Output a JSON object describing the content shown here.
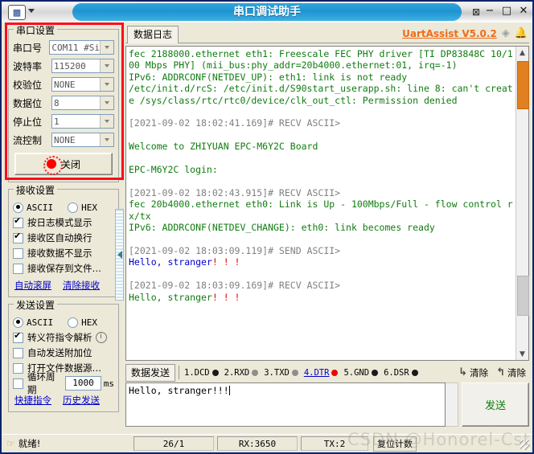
{
  "window": {
    "title": "串口调试助手",
    "icon": "app-icon",
    "minimize": "−",
    "maximize": "□",
    "close": "✕",
    "pin": "⊠"
  },
  "serial_settings": {
    "legend": "串口设置",
    "fields": [
      {
        "label": "串口号",
        "value": "COM11 #Si"
      },
      {
        "label": "波特率",
        "value": "115200"
      },
      {
        "label": "校验位",
        "value": "NONE"
      },
      {
        "label": "数据位",
        "value": "8"
      },
      {
        "label": "停止位",
        "value": "1"
      },
      {
        "label": "流控制",
        "value": "NONE"
      }
    ],
    "close_button": "关闭",
    "led_color": "#ff0000",
    "highlight_color": "#fc0d1b"
  },
  "recv_settings": {
    "legend": "接收设置",
    "mode_ascii": "ASCII",
    "mode_hex": "HEX",
    "checkboxes": [
      {
        "label": "按日志模式显示",
        "checked": true
      },
      {
        "label": "接收区自动换行",
        "checked": true
      },
      {
        "label": "接收数据不显示",
        "checked": false
      },
      {
        "label": "接收保存到文件…",
        "checked": false
      }
    ],
    "link_autoscroll": "自动滚屏",
    "link_clear": "清除接收"
  },
  "send_settings": {
    "legend": "发送设置",
    "mode_ascii": "ASCII",
    "mode_hex": "HEX",
    "checkboxes": [
      {
        "label": "转义符指令解析",
        "checked": true,
        "info": true
      },
      {
        "label": "自动发送附加位",
        "checked": false
      },
      {
        "label": "打开文件数据源…",
        "checked": false
      }
    ],
    "cycle_label": "循环周期",
    "cycle_value": "1000",
    "cycle_unit": "ms",
    "cycle_checked": false,
    "link_shortcut": "快捷指令",
    "link_history": "历史发送"
  },
  "log_panel": {
    "tab": "数据日志",
    "version": "UartAssist V5.0.2",
    "gem_icon": "gem-icon",
    "bell_icon": "bell-icon",
    "lines": [
      {
        "text": "fec 2188000.ethernet eth1: Freescale FEC PHY driver [TI DP83848C 10/100 Mbps PHY] (mii_bus:phy_addr=20b4000.ethernet:01, irq=-1)",
        "color": "green"
      },
      {
        "text": "IPv6: ADDRCONF(NETDEV_UP): eth1: link is not ready",
        "color": "green"
      },
      {
        "text": "/etc/init.d/rcS: /etc/init.d/S90start_userapp.sh: line 8: can't create /sys/class/rtc/rtc0/device/clk_out_ctl: Permission denied",
        "color": "green"
      },
      {
        "text": "",
        "color": "green"
      },
      {
        "text": "[2021-09-02 18:02:41.169]# RECV ASCII>",
        "color": "gray"
      },
      {
        "text": "",
        "color": "green"
      },
      {
        "text": "Welcome to ZHIYUAN EPC-M6Y2C Board",
        "color": "green"
      },
      {
        "text": "",
        "color": "green"
      },
      {
        "text": "EPC-M6Y2C login:",
        "color": "green"
      },
      {
        "text": "",
        "color": "green"
      },
      {
        "text": "[2021-09-02 18:02:43.915]# RECV ASCII>",
        "color": "gray"
      },
      {
        "text": "fec 20b4000.ethernet eth0: Link is Up - 100Mbps/Full - flow control rx/tx",
        "color": "green"
      },
      {
        "text": "IPv6: ADDRCONF(NETDEV_CHANGE): eth0: link becomes ready",
        "color": "green"
      },
      {
        "text": "",
        "color": "green"
      },
      {
        "text": "[2021-09-02 18:03:09.119]# SEND ASCII>",
        "color": "gray"
      },
      {
        "text": "Hello, stranger!!!",
        "color": "blue"
      },
      {
        "text": "",
        "color": "green"
      },
      {
        "text": "[2021-09-02 18:03:09.169]# RECV ASCII>",
        "color": "gray"
      },
      {
        "text": "Hello, stranger!!!",
        "color": "green"
      }
    ]
  },
  "send_panel": {
    "tab": "数据发送",
    "signals": [
      {
        "name": "1.DCD",
        "state": "black",
        "active": false
      },
      {
        "name": "2.RXD",
        "state": "grey",
        "active": false
      },
      {
        "name": "3.TXD",
        "state": "grey",
        "active": false
      },
      {
        "name": "4.DTR",
        "state": "red",
        "active": true
      },
      {
        "name": "5.GND",
        "state": "black",
        "active": false
      },
      {
        "name": "6.DSR",
        "state": "black",
        "active": false
      }
    ],
    "clear_down": "清除",
    "clear_up": "清除",
    "input_value": "Hello, stranger!!!",
    "send_button": "发送"
  },
  "statusbar": {
    "ready": "就绪!",
    "ready_icon": "hand-icon",
    "position": "26/1",
    "rx": "RX:3650",
    "tx": "TX:2",
    "reset_button": "复位计数"
  },
  "watermark": "CSDN @Honorel-Cst"
}
